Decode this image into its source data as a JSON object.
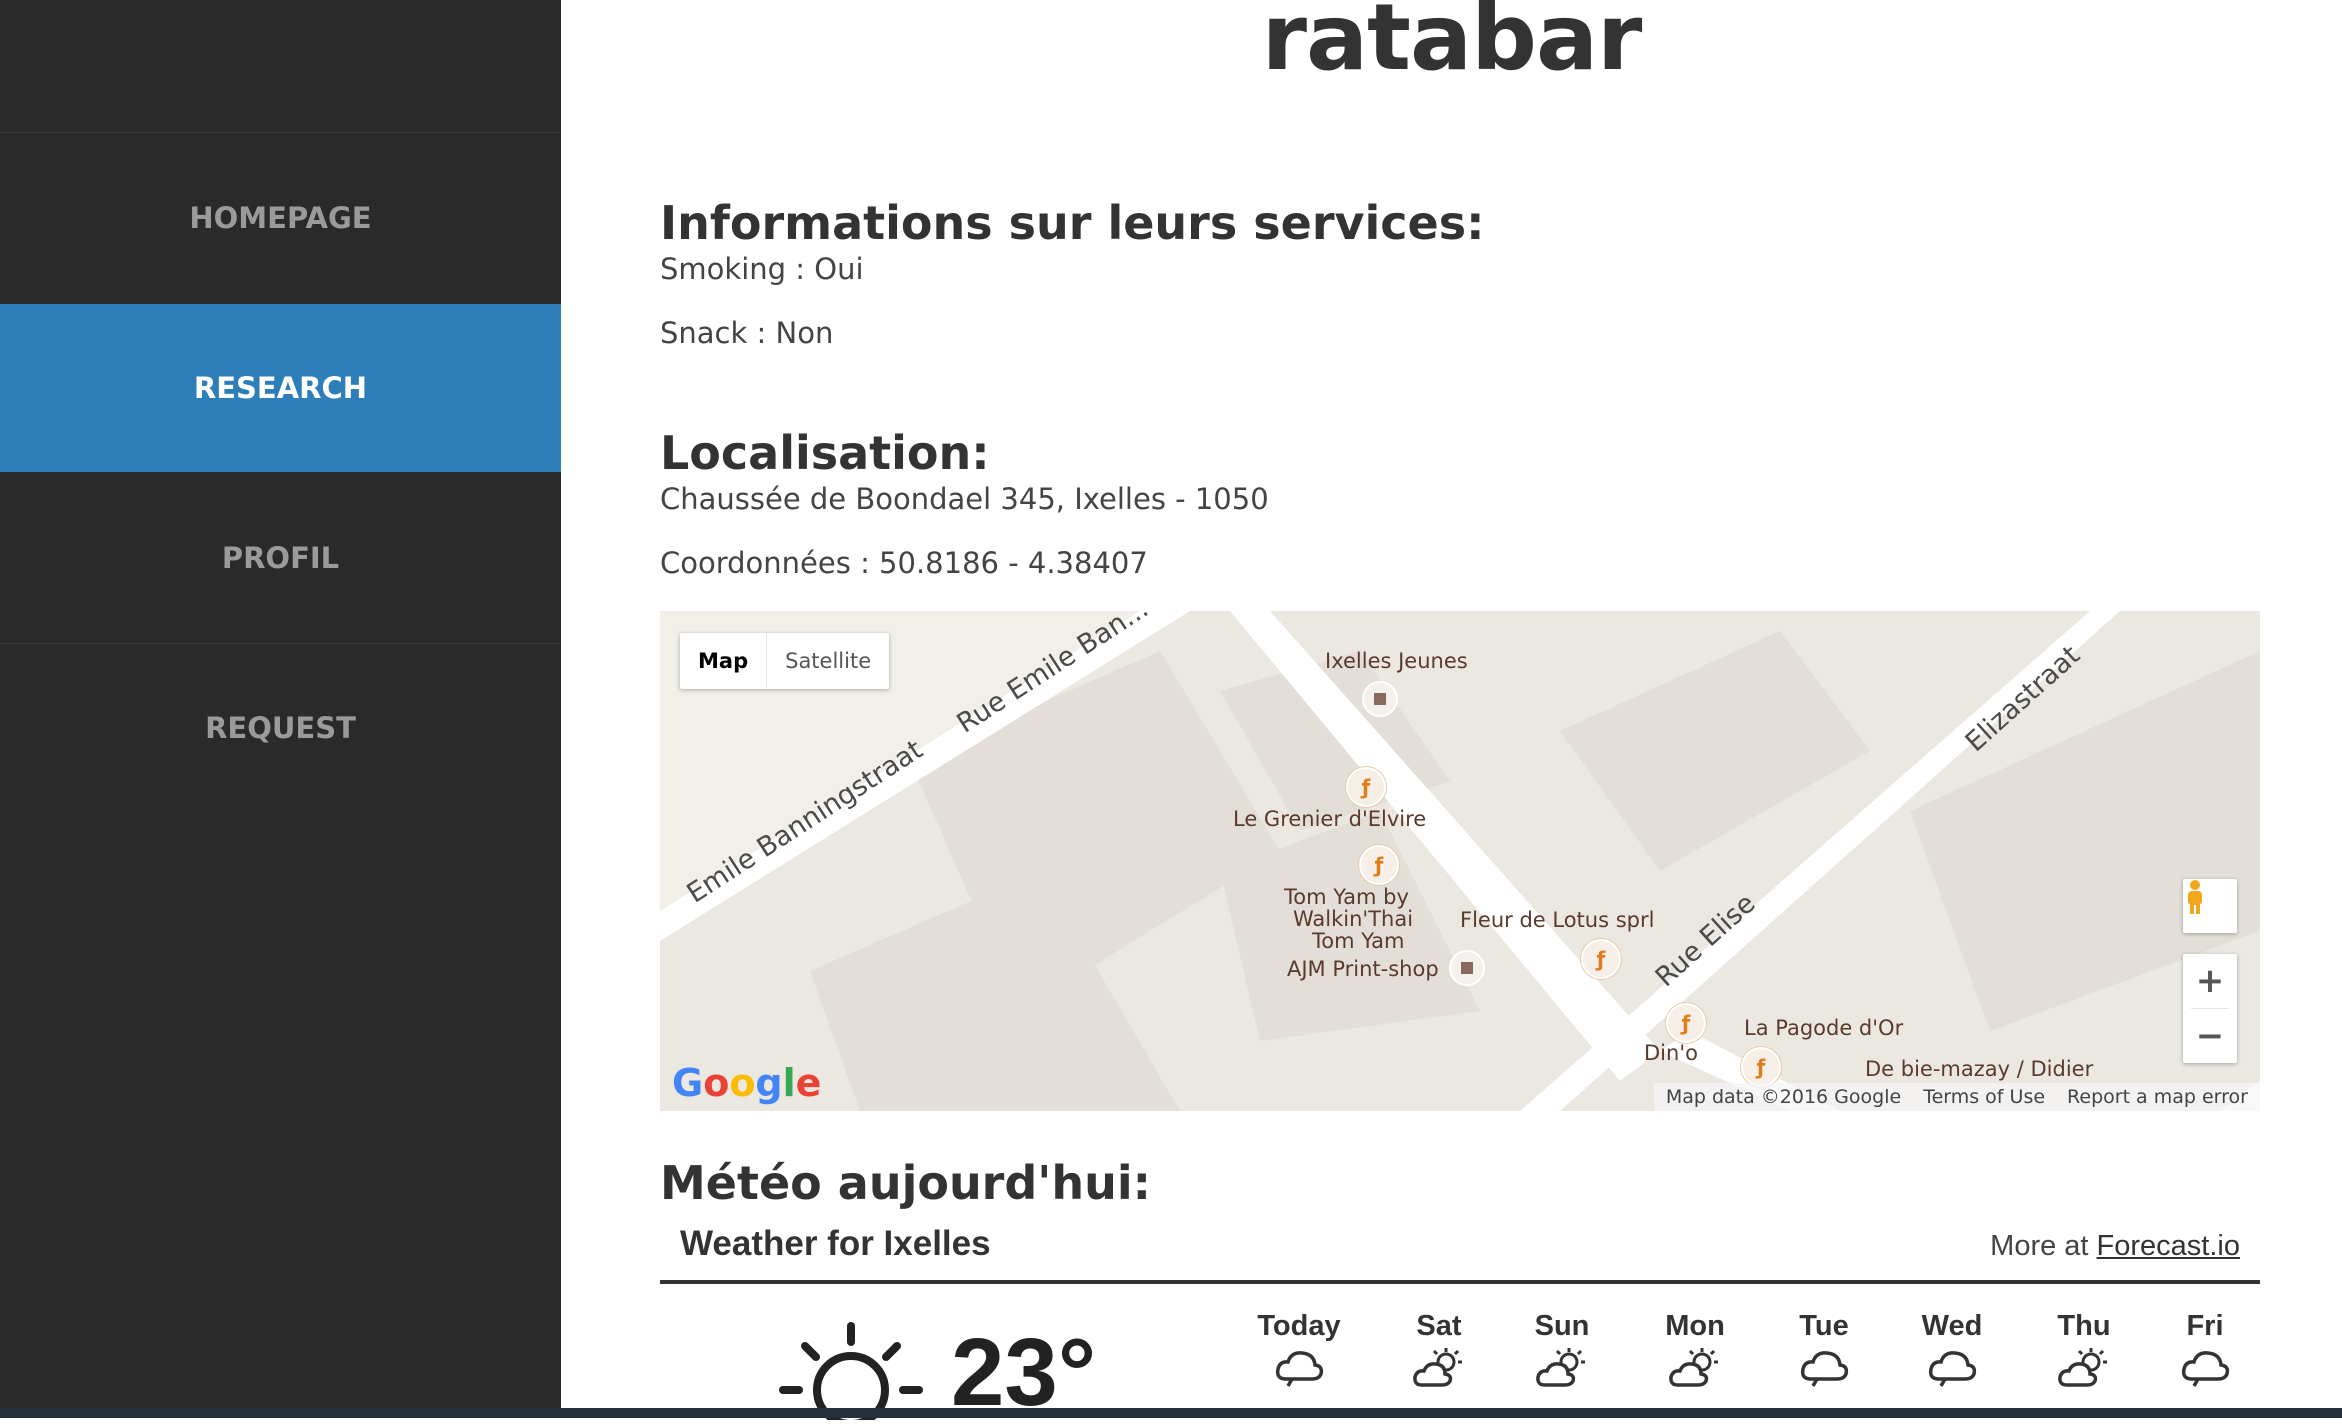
{
  "sidebar": {
    "items": [
      {
        "label": "HOMEPAGE",
        "active": false
      },
      {
        "label": "RESEARCH",
        "active": true
      },
      {
        "label": "PROFIL",
        "active": false
      },
      {
        "label": "REQUEST",
        "active": false
      }
    ],
    "active_color": "#2e7fb9",
    "background_color": "#2a2a2a"
  },
  "page": {
    "title": "ratabar"
  },
  "services": {
    "heading": "Informations sur leurs services:",
    "smoking": "Smoking : Oui",
    "snack": "Snack : Non"
  },
  "location": {
    "heading": "Localisation:",
    "address": "Chaussée de Boondael 345, Ixelles - 1050",
    "coordinates": "Coordonnées : 50.8186 - 4.38407"
  },
  "map": {
    "type_map": "Map",
    "type_satellite": "Satellite",
    "places": {
      "ixelles_jeunes": "Ixelles Jeunes",
      "grenier": "Le Grenier d'Elvire",
      "tomyam": "Tom Yam by",
      "tomyam2": "Walkin'Thai",
      "tomyam3": "Tom Yam",
      "ajm": "AJM Print-shop",
      "fleur": "Fleur de Lotus sprl",
      "pagode": "La Pagode d'Or",
      "dino": "Din'o",
      "biemazay": "De bie-mazay / Didier"
    },
    "streets": {
      "banningstraat": "Emile Banningstraat",
      "rue_emile": "Rue Emile Ban...",
      "elizastraat": "Elizastraat",
      "rue_elise": "Rue Elise"
    },
    "logo": "Google",
    "attribution": {
      "data": "Map data ©2016 Google",
      "terms": "Terms of Use",
      "report": "Report a map error"
    },
    "zoom_in": "+",
    "zoom_out": "−"
  },
  "weather": {
    "heading": "Météo aujourd'hui:",
    "title": "Weather for Ixelles",
    "more_prefix": "More at",
    "more_link": "Forecast.io",
    "current_temp": "23°",
    "current_icon": "sun-icon",
    "days": [
      {
        "name": "Today",
        "icon": "cloud-icon"
      },
      {
        "name": "Sat",
        "icon": "partly-cloudy-icon"
      },
      {
        "name": "Sun",
        "icon": "partly-cloudy-icon"
      },
      {
        "name": "Mon",
        "icon": "partly-cloudy-icon"
      },
      {
        "name": "Tue",
        "icon": "cloud-icon"
      },
      {
        "name": "Wed",
        "icon": "cloud-icon"
      },
      {
        "name": "Thu",
        "icon": "partly-cloudy-icon"
      },
      {
        "name": "Fri",
        "icon": "cloud-icon"
      }
    ]
  }
}
